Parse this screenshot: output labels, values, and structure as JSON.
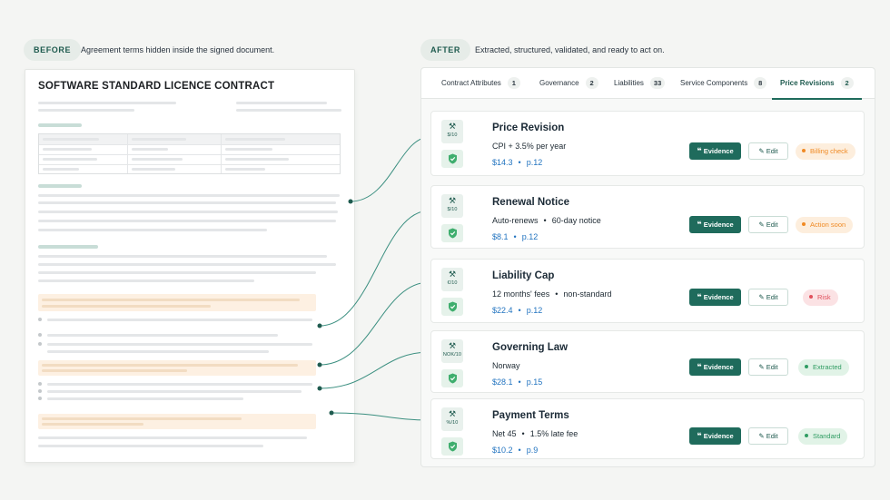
{
  "header": {
    "before_label": "BEFORE",
    "before_caption": "Agreement terms hidden inside the signed document.",
    "after_label": "AFTER",
    "after_caption": "Extracted, structured, validated, and ready to act on."
  },
  "document": {
    "title": "SOFTWARE STANDARD LICENCE CONTRACT"
  },
  "tabs": [
    {
      "label": "Contract Attributes",
      "count": "1"
    },
    {
      "label": "Governance",
      "count": "2"
    },
    {
      "label": "Liabilities",
      "count": "33"
    },
    {
      "label": "Service Components",
      "count": "8"
    },
    {
      "label": "Price Revisions",
      "count": "2"
    }
  ],
  "active_tab": "Price Revisions",
  "buttons": {
    "evidence": "Evidence",
    "edit": "Edit"
  },
  "cards": [
    {
      "title": "Price Revision",
      "detail": [
        "CPI + 3.5% per year"
      ],
      "value": "$14.3",
      "page": "p.12",
      "unit": "$/10",
      "status": "Billing check",
      "status_color": "#f08a24"
    },
    {
      "title": "Renewal Notice",
      "detail": [
        "Auto-renews",
        "60-day notice"
      ],
      "value": "$8.1",
      "page": "p.12",
      "unit": "$/10",
      "status": "Action soon",
      "status_color": "#f08a24"
    },
    {
      "title": "Liability Cap",
      "detail": [
        "12 months' fees",
        "non-standard"
      ],
      "value": "$22.4",
      "page": "p.12",
      "unit": "€/10",
      "status": "Risk",
      "status_color": "#e0505c"
    },
    {
      "title": "Governing Law",
      "detail": [
        "Norway"
      ],
      "value": "$28.1",
      "page": "p.15",
      "unit": "NOK/10",
      "status": "Extracted",
      "status_color": "#2f9c62"
    },
    {
      "title": "Payment Terms",
      "detail": [
        "Net 45",
        "1.5% late fee"
      ],
      "value": "$10.2",
      "page": "p.9",
      "unit": "%/10",
      "status": "Standard",
      "status_color": "#2f9c62"
    }
  ],
  "icons": {
    "card_top": "tool-icon",
    "card_bottom": "shield-check-icon",
    "evidence": "quote-icon",
    "edit": "pencil-icon"
  },
  "colors": {
    "brand": "#1f6b5c",
    "link": "#2274c0",
    "warning": "#f08a24",
    "risk": "#e0505c",
    "success": "#2f9c62"
  }
}
